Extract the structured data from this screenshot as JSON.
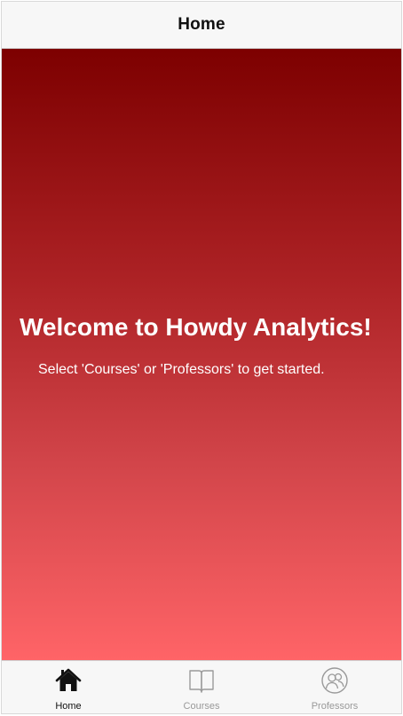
{
  "header": {
    "title": "Home"
  },
  "main": {
    "title": "Welcome to Howdy Analytics!",
    "subtitle": "Select 'Courses' or 'Professors' to get started.",
    "gradient": [
      "#7d0000",
      "#ff6467"
    ]
  },
  "tabbar": {
    "tabs": [
      {
        "label": "Home",
        "icon": "home-icon",
        "active": true
      },
      {
        "label": "Courses",
        "icon": "book-icon",
        "active": false
      },
      {
        "label": "Professors",
        "icon": "users-icon",
        "active": false
      }
    ],
    "active_color": "#111111",
    "inactive_color": "#999999"
  }
}
